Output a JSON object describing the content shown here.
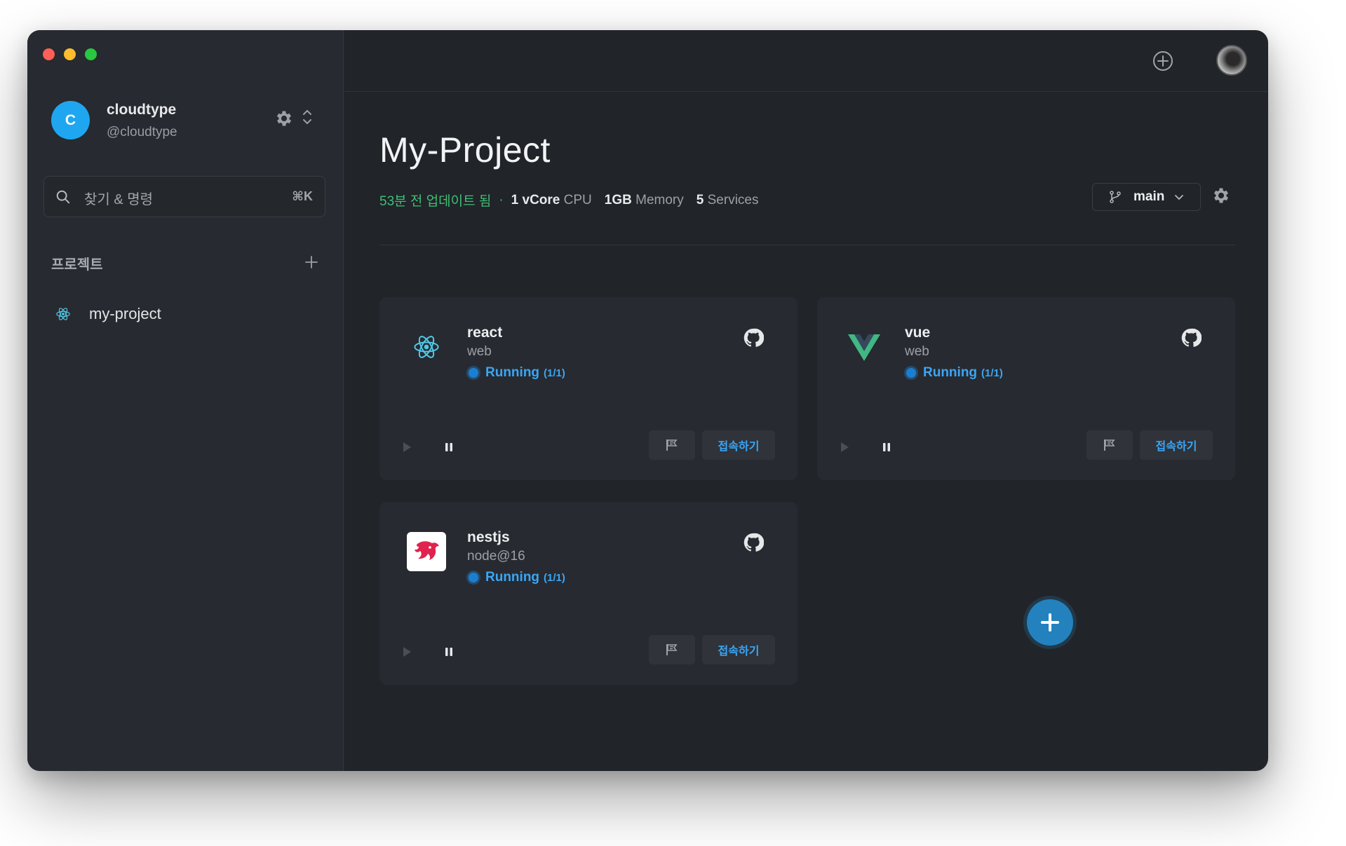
{
  "window": {
    "controls": [
      "close",
      "minimize",
      "maximize"
    ]
  },
  "account": {
    "initial": "C",
    "name": "cloudtype",
    "handle": "@cloudtype",
    "avatar_color": "#1ea7f0"
  },
  "search": {
    "placeholder": "찾기 & 명령",
    "shortcut": "⌘K"
  },
  "projects": {
    "heading": "프로젝트",
    "items": [
      {
        "label": "my-project",
        "icon": "react-icon"
      }
    ]
  },
  "topbar": {
    "icons": [
      "add-circle-icon",
      "user-avatar"
    ]
  },
  "project": {
    "title": "My-Project",
    "updated": "53분 전 업데이트 됨",
    "separator": "·",
    "cpu_value": "1 vCore",
    "cpu_label": "CPU",
    "memory_value": "1GB",
    "memory_label": "Memory",
    "services_value": "5",
    "services_label": "Services",
    "branch": "main"
  },
  "services": [
    {
      "name": "react",
      "type": "web",
      "status": "Running",
      "instances": "(1/1)",
      "icon": "react-icon",
      "connect_label": "접속하기"
    },
    {
      "name": "vue",
      "type": "web",
      "status": "Running",
      "instances": "(1/1)",
      "icon": "vue-icon",
      "connect_label": "접속하기"
    },
    {
      "name": "nestjs",
      "type": "node@16",
      "status": "Running",
      "instances": "(1/1)",
      "icon": "nestjs-icon",
      "connect_label": "접속하기"
    }
  ],
  "colors": {
    "accent": "#3aa6f5",
    "success": "#3fbf74",
    "background": "#212429",
    "sidebar": "#272a30"
  }
}
